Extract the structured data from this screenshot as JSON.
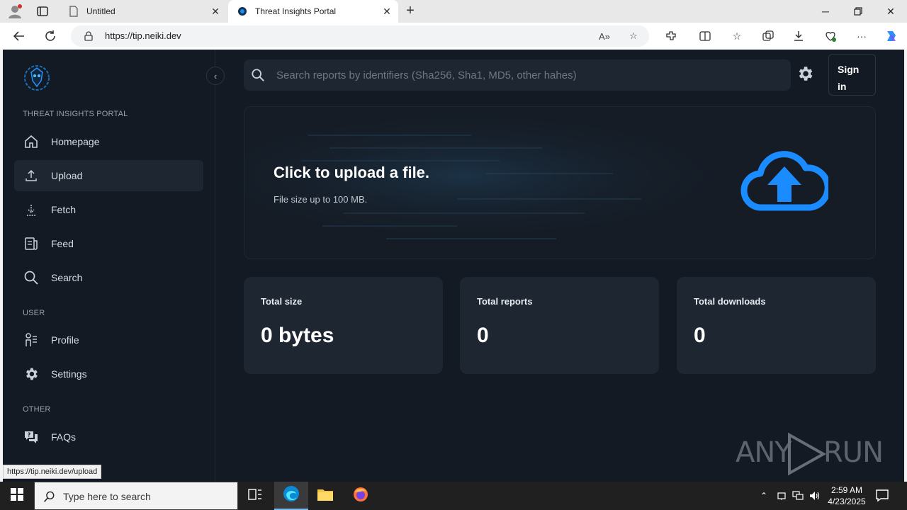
{
  "browser": {
    "tabs": [
      {
        "label": "Untitled"
      },
      {
        "label": "Threat Insights Portal"
      }
    ],
    "url": "https://tip.neiki.dev",
    "status_url": "https://tip.neiki.dev/upload"
  },
  "sidebar": {
    "section_main": "THREAT INSIGHTS PORTAL",
    "main_items": [
      {
        "label": "Homepage",
        "icon": "home-icon"
      },
      {
        "label": "Upload",
        "icon": "upload-icon",
        "active": true
      },
      {
        "label": "Fetch",
        "icon": "download-icon"
      },
      {
        "label": "Feed",
        "icon": "feed-icon"
      },
      {
        "label": "Search",
        "icon": "search-icon"
      }
    ],
    "section_user": "USER",
    "user_items": [
      {
        "label": "Profile",
        "icon": "profile-icon"
      },
      {
        "label": "Settings",
        "icon": "gear-icon"
      }
    ],
    "section_other": "OTHER",
    "other_items": [
      {
        "label": "FAQs",
        "icon": "faq-icon"
      }
    ]
  },
  "header": {
    "search_placeholder": "Search reports by identifiers (Sha256, Sha1, MD5, other hahes)",
    "signin_label": "Sign in"
  },
  "upload": {
    "title": "Click to upload a file.",
    "subtitle": "File size up to 100 MB."
  },
  "stats": [
    {
      "label": "Total size",
      "value": "0 bytes"
    },
    {
      "label": "Total reports",
      "value": "0"
    },
    {
      "label": "Total downloads",
      "value": "0"
    }
  ],
  "watermark": {
    "left": "ANY",
    "right": "RUN"
  },
  "taskbar": {
    "search_placeholder": "Type here to search",
    "time": "2:59 AM",
    "date": "4/23/2025"
  },
  "colors": {
    "page_bg": "#131a23",
    "card_bg": "#1e2631",
    "accent": "#1a8cff"
  }
}
